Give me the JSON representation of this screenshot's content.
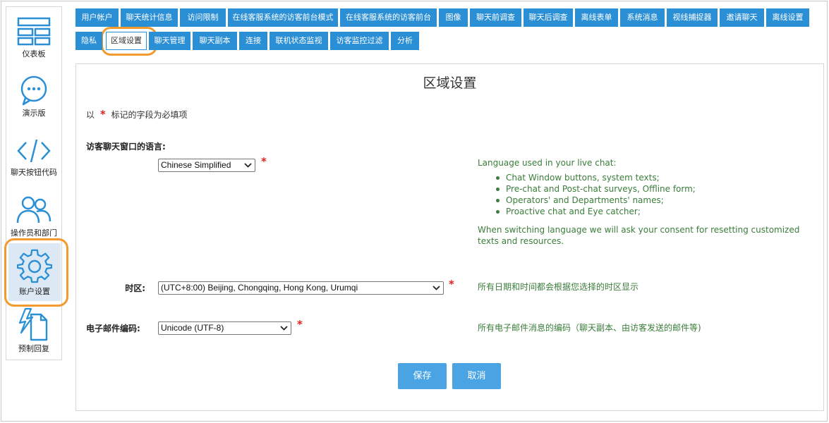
{
  "sidebar": {
    "items": [
      {
        "label": "仪表板",
        "icon": "dashboard-icon"
      },
      {
        "label": "演示版",
        "icon": "chat-bubble-icon"
      },
      {
        "label": "聊天按钮代码",
        "icon": "code-icon"
      },
      {
        "label": "操作员和部门",
        "icon": "users-icon"
      },
      {
        "label": "账户设置",
        "icon": "gear-icon"
      },
      {
        "label": "预制回复",
        "icon": "canned-reply-icon"
      }
    ],
    "active_index": 4
  },
  "tabs": [
    "用户帐户",
    "聊天统计信息",
    "访问限制",
    "在线客服系统的访客前台模式",
    "在线客服系统的访客前台",
    "图像",
    "聊天前调查",
    "聊天后调查",
    "离线表单",
    "系统消息",
    "视线捕捉器",
    "邀请聊天",
    "离线设置",
    "隐私",
    "区域设置",
    "聊天管理",
    "聊天副本",
    "连接",
    "联机状态监视",
    "访客监控过滤",
    "分析"
  ],
  "active_tab": "区域设置",
  "panel": {
    "title": "区域设置",
    "required_note_prefix": "以",
    "required_star": "*",
    "required_note_suffix": "标记的字段为必填项",
    "language": {
      "label": "访客聊天窗口的语言:",
      "value": "Chinese Simplified",
      "help_intro": "Language used in your live chat:",
      "help_items": [
        "Chat Window buttons, system texts;",
        "Pre-chat and Post-chat surveys, Offline form;",
        "Operators' and Departments' names;",
        "Proactive chat and Eye catcher;"
      ],
      "help_outro": "When switching language we will ask your consent for resetting customized texts and resources."
    },
    "timezone": {
      "label": "时区:",
      "value": "(UTC+8:00) Beijing, Chongqing, Hong Kong, Urumqi",
      "help": "所有日期和时间都会根据您选择的时区显示"
    },
    "email_encoding": {
      "label": "电子邮件编码:",
      "value": "Unicode (UTF-8)",
      "help": "所有电子邮件消息的编码（聊天副本、由访客发送的邮件等)"
    },
    "buttons": {
      "save": "保存",
      "cancel": "取消"
    }
  },
  "colors": {
    "accent": "#2b8fd6",
    "button": "#4aa3e3",
    "callout": "#f39a2e",
    "required": "#e02020",
    "help_text": "#3a7d3a"
  }
}
